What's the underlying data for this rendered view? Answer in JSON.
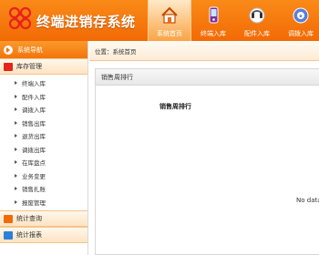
{
  "header": {
    "app_title": "终端进销存系统",
    "nav": [
      {
        "label": "系统首页",
        "icon": "home-icon",
        "active": true
      },
      {
        "label": "终端入库",
        "icon": "terminal-inbound-icon",
        "active": false
      },
      {
        "label": "配件入库",
        "icon": "accessory-inbound-icon",
        "active": false
      },
      {
        "label": "调拨入库",
        "icon": "transfer-inbound-icon",
        "active": false
      }
    ]
  },
  "sidebar": {
    "title": "系统导航",
    "groups": [
      {
        "label": "库存管理",
        "items": [
          "终端入库",
          "配件入库",
          "调拨入库",
          "销售出库",
          "退货出库",
          "调拨出库",
          "在库盘点",
          "业务变更",
          "销售扎账",
          "报废管理"
        ]
      },
      {
        "label": "统计查询",
        "items": []
      },
      {
        "label": "统计报表",
        "items": []
      }
    ]
  },
  "main": {
    "breadcrumb_prefix": "位置：",
    "breadcrumb_current": "系统首页",
    "panel_title": "销售周排行",
    "chart": {
      "title": "销售周排行",
      "no_data_text": "No data"
    }
  },
  "colors": {
    "brand_orange": "#f36a05",
    "header_gradient_top": "#f98a18",
    "logo_red": "#e8231a"
  }
}
